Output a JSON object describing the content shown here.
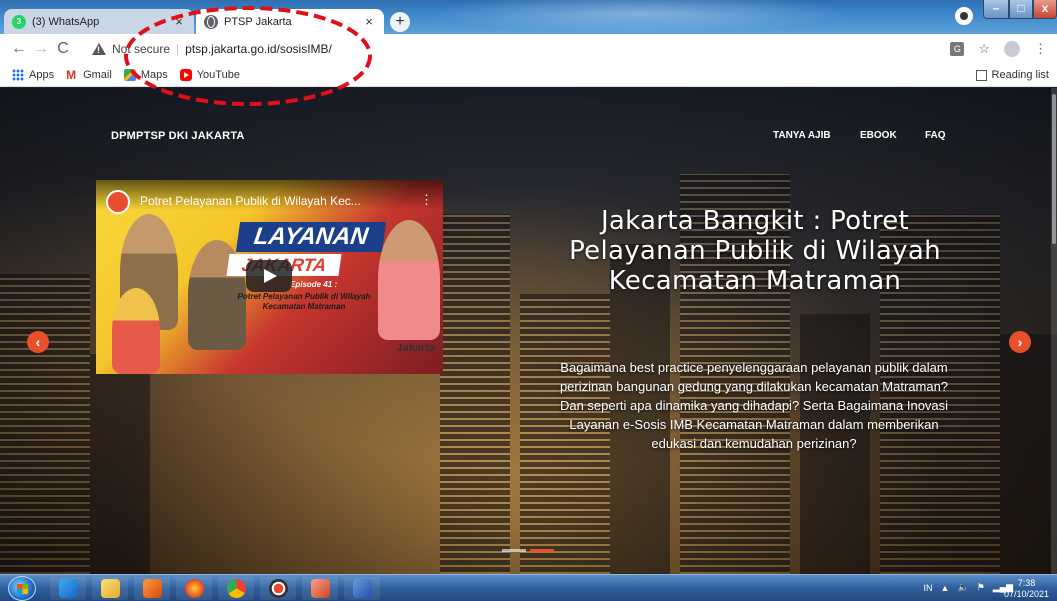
{
  "browser": {
    "tabs": [
      {
        "title": "(3) WhatsApp",
        "icon": "whatsapp-icon"
      },
      {
        "title": "PTSP Jakarta",
        "icon": "globe-icon"
      }
    ],
    "address": {
      "security_label": "Not secure",
      "url": "ptsp.jakarta.go.id/sosisIMB/"
    },
    "bookmarks": [
      {
        "label": "Apps",
        "icon": "apps-grid-icon"
      },
      {
        "label": "Gmail",
        "icon": "gmail-icon"
      },
      {
        "label": "Maps",
        "icon": "maps-icon"
      },
      {
        "label": "YouTube",
        "icon": "youtube-icon"
      }
    ],
    "reading_list": "Reading list"
  },
  "site": {
    "brand": "DPMPTSP DKI JAKARTA",
    "nav": [
      "TANYA AJIB",
      "EBOOK",
      "FAQ"
    ]
  },
  "hero": {
    "video": {
      "title": "Potret Pelayanan Publik di Wilayah Kec...",
      "banner_top": "LAYANAN",
      "banner_bottom": "JAKARTA",
      "episode": "Episode 41 :",
      "subtitle": "Potret Pelayanan Publik di Wilayah Kecamatan Matraman",
      "footer_logo": "Jakarta"
    },
    "headline": "Jakarta Bangkit : Potret Pelayanan Publik di Wilayah Kecamatan Matraman",
    "description": "Bagaimana best practice penyelenggaraan pelayanan publik dalam perizinan bangunan gedung yang dilakukan kecamatan Matraman? Dan seperti apa dinamika yang dihadapi? Serta Bagaimana Inovasi Layanan e-Sosis IMB Kecamatan Matraman dalam memberikan edukasi dan kemudahan perizinan?",
    "carousel_count": 2,
    "carousel_active": 2
  },
  "taskbar": {
    "apps": [
      "internet-explorer-icon",
      "file-explorer-icon",
      "media-player-icon",
      "firefox-icon",
      "chrome-icon",
      "record-app-icon",
      "powerpoint-icon",
      "word-icon"
    ],
    "language": "IN",
    "time": "7:38",
    "date": "07/10/2021"
  },
  "colors": {
    "accent": "#e8502c",
    "annotation": "#e0101a"
  }
}
